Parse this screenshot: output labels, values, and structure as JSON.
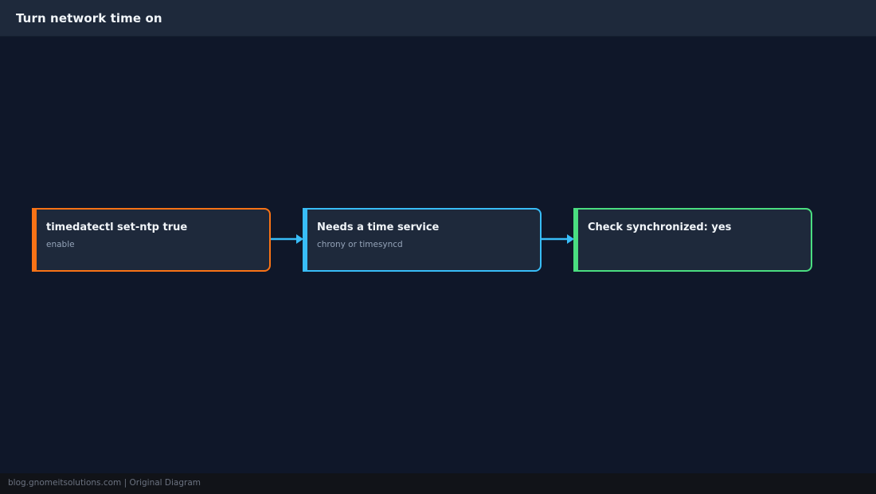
{
  "header": {
    "title": "Turn network time on"
  },
  "nodes": [
    {
      "title": "timedatectl set-ntp true",
      "subtitle": "enable",
      "color": "#f97316"
    },
    {
      "title": "Needs a time service",
      "subtitle": "chrony or timesyncd",
      "color": "#38bdf8"
    },
    {
      "title": "Check synchronized: yes",
      "subtitle": "",
      "color": "#4ade80"
    }
  ],
  "connector_color": "#38bdf8",
  "footer": {
    "text": "blog.gnomeitsolutions.com | Original Diagram"
  }
}
